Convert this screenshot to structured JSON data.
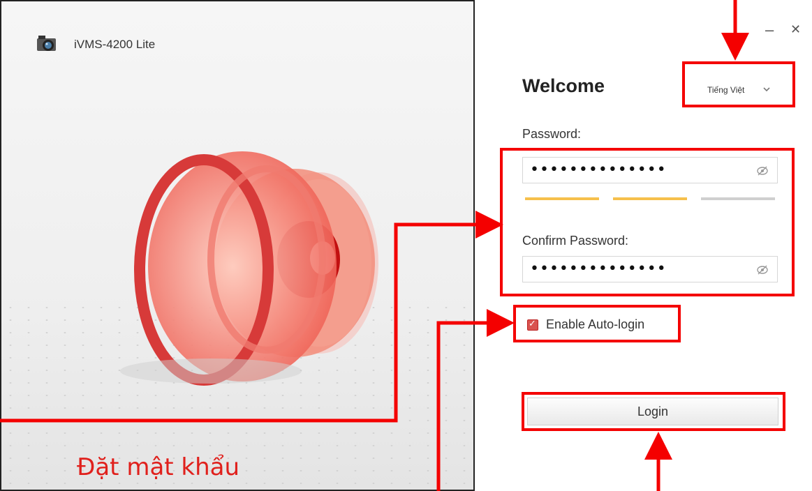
{
  "window": {
    "app_title": "iVMS-4200 Lite",
    "minimize_glyph": "–",
    "close_glyph": "✕"
  },
  "login": {
    "heading": "Welcome",
    "language": "Tiếng Việt",
    "password_label": "Password:",
    "password_value": "••••••••••••••",
    "confirm_label": "Confirm Password:",
    "confirm_value": "••••••••••••••",
    "auto_login_label": "Enable Auto-login",
    "auto_login_checked": true,
    "login_button": "Login",
    "password_strength_segments_filled": 2,
    "password_strength_segments_total": 3
  },
  "annotation": {
    "caption": "Đặt mật khẩu",
    "highlight_color": "#f40000",
    "caption_color": "#e0201c"
  },
  "icons": {
    "app_logo": "camera-icon",
    "reveal": "eye-slash-icon",
    "dropdown": "chevron-down-icon",
    "check": "checkmark-icon"
  },
  "colors": {
    "strength_filled": "#f6c04c",
    "strength_empty": "#cfcfcf"
  }
}
